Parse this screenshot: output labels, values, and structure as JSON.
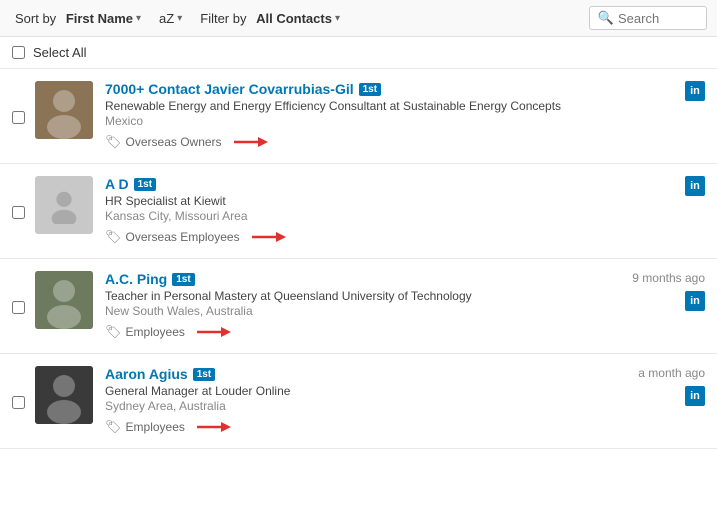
{
  "toolbar": {
    "sort_label": "Sort by",
    "sort_field": "First Name",
    "sort_direction": "aZ",
    "filter_label": "Filter by",
    "filter_value": "All Contacts",
    "search_placeholder": "Search"
  },
  "select_all_label": "Select All",
  "contacts": [
    {
      "id": 1,
      "name": "7000+ Contact Javier Covarrubias-Gil",
      "degree": "1st",
      "title": "Renewable Energy and Energy Efficiency Consultant at Sustainable Energy Concepts",
      "location": "Mexico",
      "tag": "Overseas Owners",
      "time_ago": "",
      "has_avatar": true,
      "avatar_color": "#8B7355"
    },
    {
      "id": 2,
      "name": "A D",
      "degree": "1st",
      "title": "HR Specialist at Kiewit",
      "location": "Kansas City, Missouri Area",
      "tag": "Overseas Employees",
      "time_ago": "",
      "has_avatar": false,
      "avatar_color": "#c8c8c8"
    },
    {
      "id": 3,
      "name": "A.C. Ping",
      "degree": "1st",
      "title": "Teacher in Personal Mastery at Queensland University of Technology",
      "location": "New South Wales, Australia",
      "tag": "Employees",
      "time_ago": "9 months ago",
      "has_avatar": true,
      "avatar_color": "#6e7a5e"
    },
    {
      "id": 4,
      "name": "Aaron Agius",
      "degree": "1st",
      "title": "General Manager at Louder Online",
      "location": "Sydney Area, Australia",
      "tag": "Employees",
      "time_ago": "a month ago",
      "has_avatar": true,
      "avatar_color": "#3a3a3a"
    }
  ]
}
